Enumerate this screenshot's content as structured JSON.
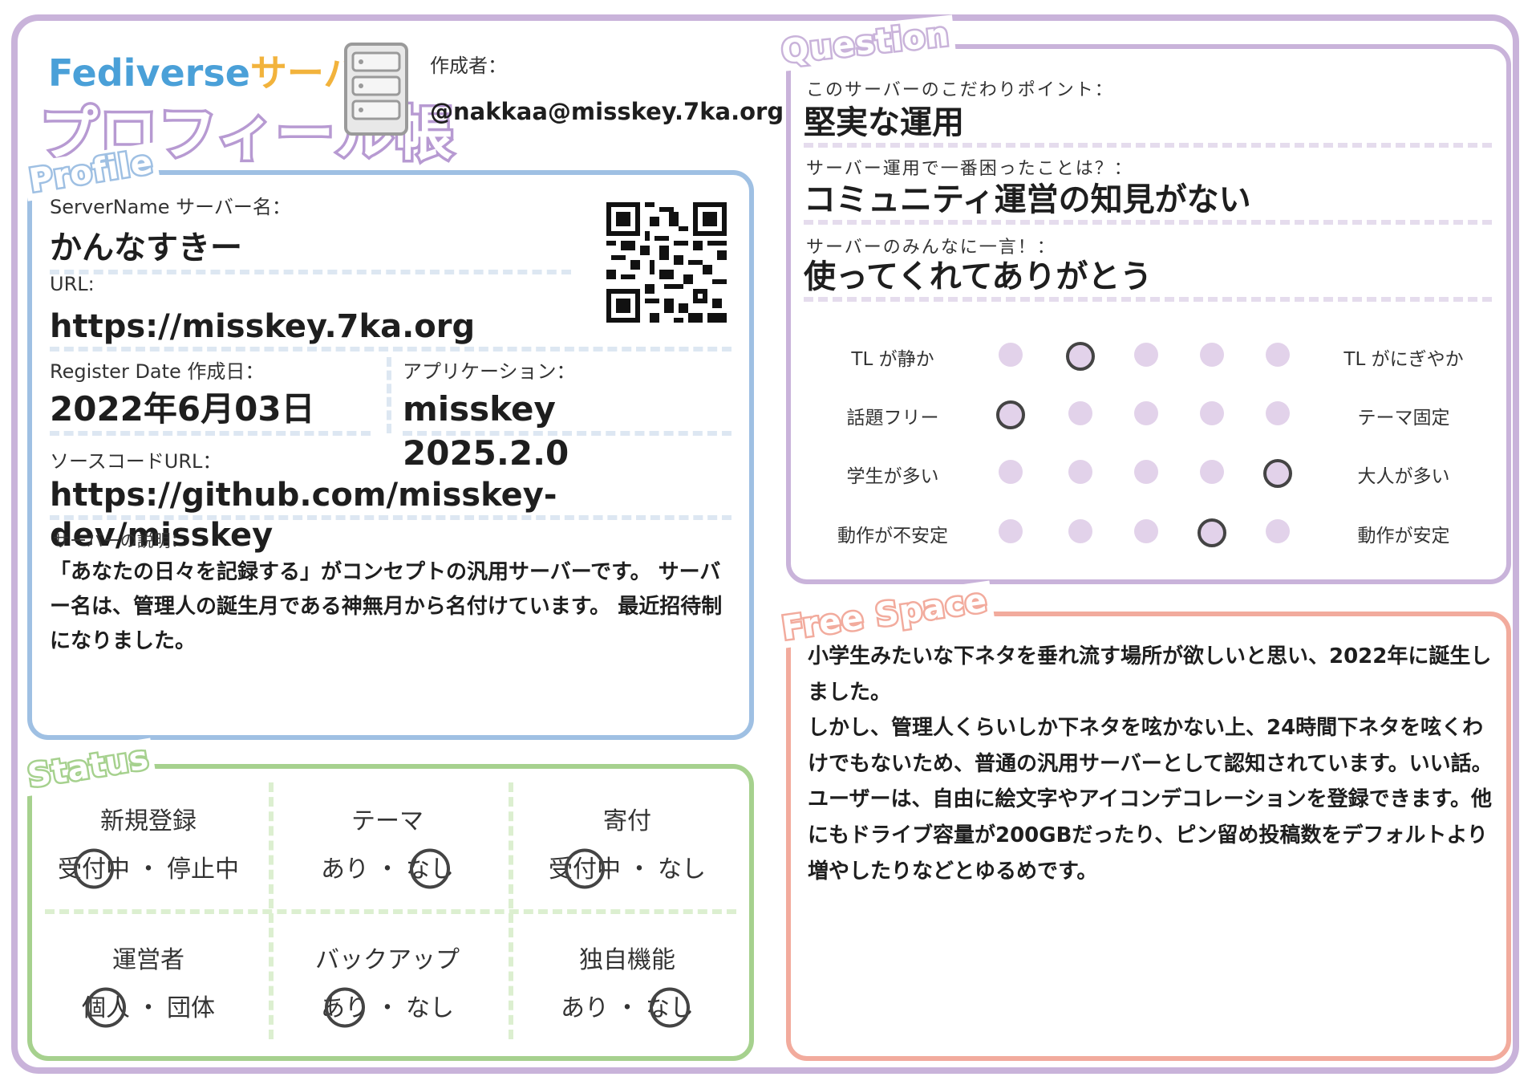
{
  "header": {
    "title_en_main": "Fediverse",
    "title_en_accent": "サーバー",
    "title_jp": "プロフィール帳",
    "creator_label": "作成者：",
    "creator_value": "@nakkaa@misskey.7ka.org"
  },
  "sections": {
    "profile": "Profile",
    "status": "Status",
    "question": "Question",
    "free_space": "Free Space"
  },
  "profile": {
    "server_name_label": "ServerName サーバー名：",
    "server_name_value": "かんなすきー",
    "url_label": "URL:",
    "url_value": "https://misskey.7ka.org",
    "register_date_label": "Register Date 作成日：",
    "register_date_value": "2022年6月03日",
    "application_label": "アプリケーション：",
    "application_value": "misskey 2025.2.0",
    "source_url_label": "ソースコードURL：",
    "source_url_value": "https://github.com/misskey-dev/misskey",
    "description_label": "サーバーの説明：",
    "description_value": "「あなたの日々を記録する」がコンセプトの汎用サーバーです。 サーバー名は、管理人の誕生月である神無月から名付けています。 最近招待制になりました。"
  },
  "status": {
    "items": [
      {
        "title": "新規登録",
        "options": [
          "受付中",
          "停止中"
        ],
        "selected": 0
      },
      {
        "title": "テーマ",
        "options": [
          "あり",
          "なし"
        ],
        "selected": 1
      },
      {
        "title": "寄付",
        "options": [
          "受付中",
          "なし"
        ],
        "selected": 0
      },
      {
        "title": "運営者",
        "options": [
          "個人",
          "団体"
        ],
        "selected": 0
      },
      {
        "title": "バックアップ",
        "options": [
          "あり",
          "なし"
        ],
        "selected": 0
      },
      {
        "title": "独自機能",
        "options": [
          "あり",
          "なし"
        ],
        "selected": 1
      }
    ],
    "separator": "・"
  },
  "question": {
    "q1_label": "このサーバーのこだわりポイント：",
    "q1_value": "堅実な運用",
    "q2_label": "サーバー運用で一番困ったことは？：",
    "q2_value": "コミュニティ運営の知見がない",
    "q3_label": "サーバーのみんなに一言！：",
    "q3_value": "使ってくれてありがとう"
  },
  "scales": [
    {
      "left": "TL が静か",
      "right": "TL がにぎやか",
      "selected": 2,
      "steps": 5
    },
    {
      "left": "話題フリー",
      "right": "テーマ固定",
      "selected": 1,
      "steps": 5
    },
    {
      "left": "学生が多い",
      "right": "大人が多い",
      "selected": 5,
      "steps": 5
    },
    {
      "left": "動作が不安定",
      "right": "動作が安定",
      "selected": 4,
      "steps": 5
    }
  ],
  "free_space": {
    "text": "小学生みたいな下ネタを垂れ流す場所が欲しいと思い、2022年に誕生しました。\nしかし、管理人くらいしか下ネタを呟かない上、24時間下ネタを呟くわけでもないため、普通の汎用サーバーとして認知されています。いい話。\nユーザーは、自由に絵文字やアイコンデコレーションを登録できます。他にもドライブ容量が200GBだったり、ピン留め投稿数をデフォルトより増やしたりなどとゆるめです。"
  },
  "colors": {
    "frame": "#c9b3da",
    "profile": "#9fc0e3",
    "status": "#a6d18e",
    "question": "#c9b3da",
    "free_space": "#f2ab9d",
    "scale_dot": "#e2d2ea",
    "title_blue": "#4aa0d8",
    "title_orange": "#f2b33c"
  },
  "icons": {
    "server": "server-rack-icon",
    "qr": "qr-code-icon"
  }
}
